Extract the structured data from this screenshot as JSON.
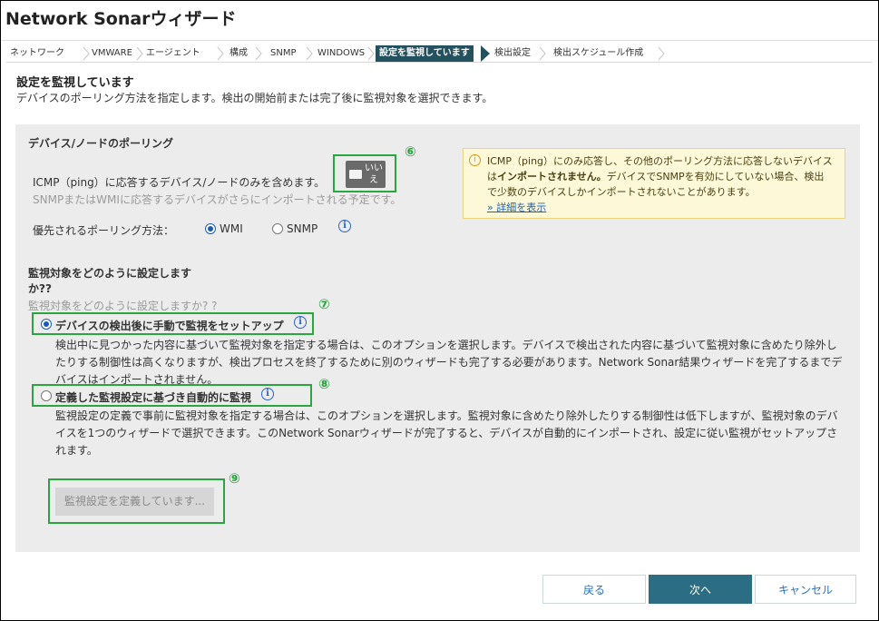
{
  "window": {
    "title": "Network Sonarウィザード"
  },
  "breadcrumb": [
    "ネットワーク",
    "VMWARE",
    "エージェント",
    "構成",
    "SNMP",
    "WINDOWS",
    "設定を監視しています",
    "検出設定",
    "検出スケジュール作成"
  ],
  "breadcrumb_active_index": 6,
  "section": {
    "title": "設定を監視しています",
    "description": "デバイスのポーリング方法を指定します。検出の開始前または完了後に監視対象を選択できます。"
  },
  "polling": {
    "heading": "デバイス/ノードのポーリング",
    "icmp_label": "ICMP（ping）に応答するデバイス/ノードのみを含めます。",
    "icmp_sublabel": "SNMPまたはWMIに応答するデバイスがさらにインポートされる予定です。",
    "toggle_label": "いいえ",
    "toggle_line1": "いい",
    "toggle_line2": "え",
    "toggle_on": false,
    "preferred_label": "優先されるポーリング方法：",
    "options": [
      "WMI",
      "SNMP"
    ],
    "selected": "WMI",
    "info_icon": "info-icon"
  },
  "warning": {
    "icon": "lightbulb-icon",
    "text_a": "ICMP（ping）にのみ応答し、その他のポーリング方法に応答しないデバイス",
    "text_b_prefix": "は",
    "text_b_bold": "インポートされません。",
    "text_b_rest": "デバイスでSNMPを有効にしていない場合、検出",
    "text_c": "で少数のデバイスしかインポートされないことがあります。",
    "more_link": "» 詳細を表示",
    "background": "#fdf9d8"
  },
  "monitoring": {
    "heading_line1": "監視対象をどのように設定します",
    "heading_line2": "か??",
    "subheading": "監視対象をどのように設定しますか? ?",
    "option_manual": {
      "label": "デバイスの検出後に手動で監視をセットアップ",
      "selected": true,
      "desc1": "検出中に見つかった内容に基づいて監視対象を指定する場合は、このオプションを選択します。デバイスで検出された内容に基づいて監視対象に含めたり除外し",
      "desc2": "たりする制御性は高くなりますが、検出プロセスを終了するために別のウィザードも完了する必要があります。Network Sonar結果ウィザードを完了するまでデ",
      "desc3": "バイスはインポートされません。"
    },
    "option_auto": {
      "label": "定義した監視設定に基づき自動的に監視",
      "selected": false,
      "desc1": "監視設定の定義で事前に監視対象を指定する場合は、このオプションを選択します。監視対象に含めたり除外したりする制御性は低下しますが、監視対象のデバ",
      "desc2": "イスを1つのウィザードで選択できます。このNetwork Sonarウィザードが完了すると、デバイスが自動的にインポートされ、設定に従い監視がセットアップさ",
      "desc3": "れます。"
    },
    "define_button": "監視設定を定義しています..."
  },
  "annotations": {
    "n6": "⑥",
    "n7": "⑦",
    "n8": "⑧",
    "n9": "⑨",
    "color": "#2aa640"
  },
  "footer": {
    "back": "戻る",
    "next": "次へ",
    "cancel": "キャンセル"
  },
  "colors": {
    "accent": "#2b6d83",
    "breadcrumb_active": "#24515e",
    "panel": "#ececec",
    "link": "#1d62b3"
  }
}
